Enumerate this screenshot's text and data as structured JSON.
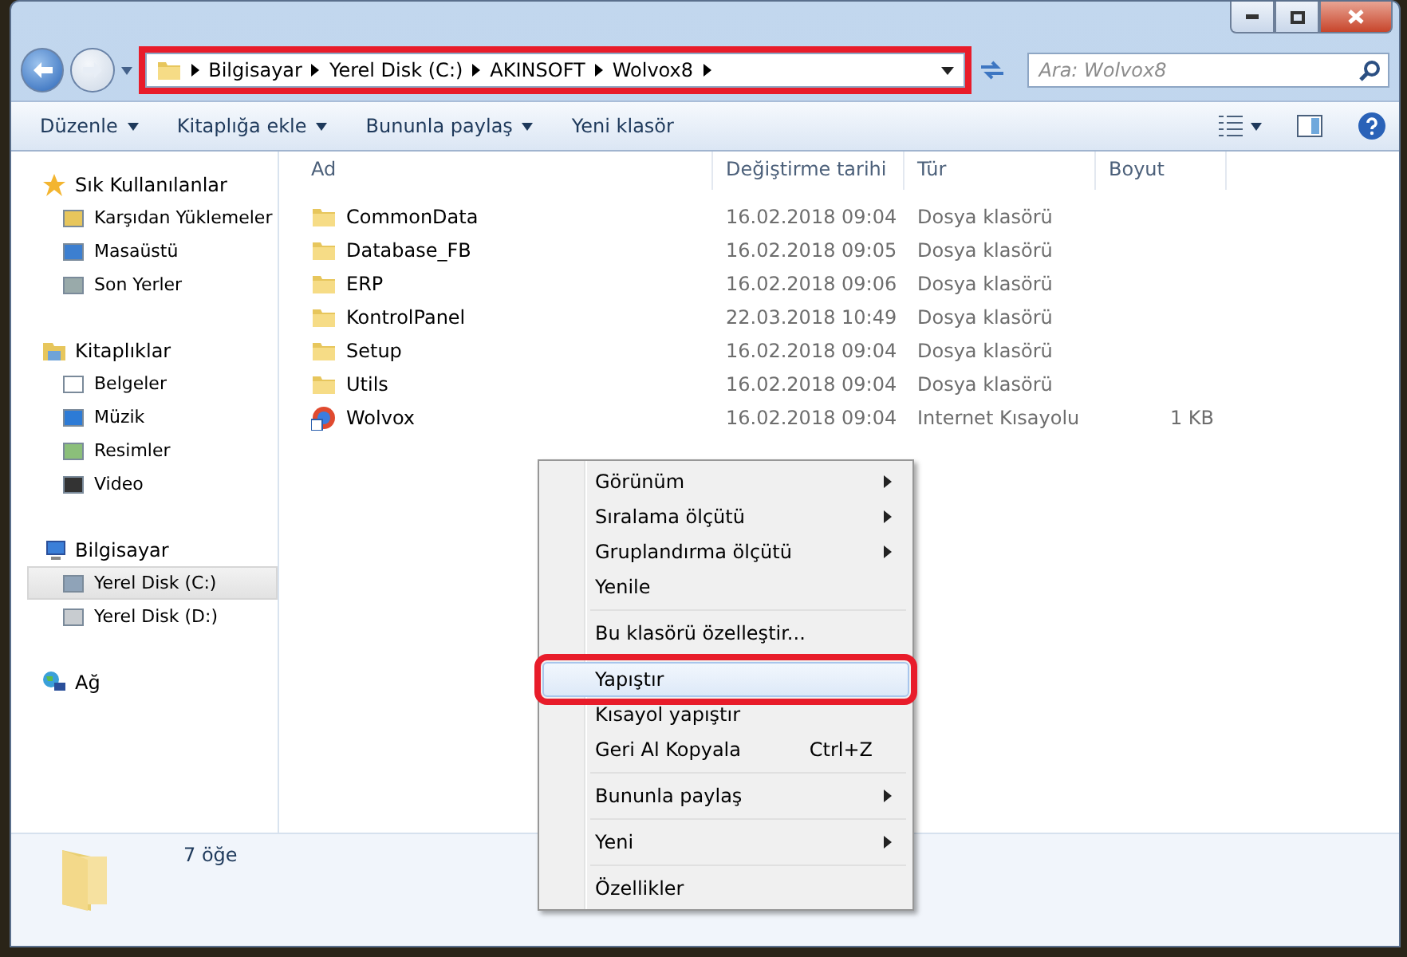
{
  "address_bar": {
    "annotated": true,
    "crumbs": [
      "Bilgisayar",
      "Yerel Disk (C:)",
      "AKINSOFT",
      "Wolvox8"
    ]
  },
  "search": {
    "placeholder": "Ara: Wolvox8"
  },
  "toolbar": {
    "buttons": [
      {
        "label": "Düzenle",
        "dropdown": true
      },
      {
        "label": "Kitaplığa ekle",
        "dropdown": true
      },
      {
        "label": "Bununla paylaş",
        "dropdown": true
      },
      {
        "label": "Yeni klasör",
        "dropdown": false
      }
    ]
  },
  "sidebar": {
    "groups": [
      {
        "label": "Sık Kullanılanlar",
        "children": [
          {
            "label": "Karşıdan Yüklemeler",
            "selected": false
          },
          {
            "label": "Masaüstü",
            "selected": false
          },
          {
            "label": "Son Yerler",
            "selected": false
          }
        ]
      },
      {
        "label": "Kitaplıklar",
        "children": [
          {
            "label": "Belgeler",
            "selected": false
          },
          {
            "label": "Müzik",
            "selected": false
          },
          {
            "label": "Resimler",
            "selected": false
          },
          {
            "label": "Video",
            "selected": false
          }
        ]
      },
      {
        "label": "Bilgisayar",
        "children": [
          {
            "label": "Yerel Disk (C:)",
            "selected": true
          },
          {
            "label": "Yerel Disk (D:)",
            "selected": false
          }
        ]
      },
      {
        "label": "Ağ"
      }
    ]
  },
  "table": {
    "columns": [
      "Ad",
      "Değiştirme tarihi",
      "Tür",
      "Boyut"
    ],
    "rows": [
      {
        "kind": "folder",
        "name": "CommonData",
        "date": "16.02.2018 09:04",
        "type": "Dosya klasörü"
      },
      {
        "kind": "folder",
        "name": "Database_FB",
        "date": "16.02.2018 09:05",
        "type": "Dosya klasörü"
      },
      {
        "kind": "folder",
        "name": "ERP",
        "date": "16.02.2018 09:06",
        "type": "Dosya klasörü"
      },
      {
        "kind": "folder",
        "name": "KontrolPanel",
        "date": "22.03.2018 10:49",
        "type": "Dosya klasörü"
      },
      {
        "kind": "folder",
        "name": "Setup",
        "date": "16.02.2018 09:04",
        "type": "Dosya klasörü"
      },
      {
        "kind": "folder",
        "name": "Utils",
        "date": "16.02.2018 09:04",
        "type": "Dosya klasörü"
      },
      {
        "kind": "shortcut",
        "name": "Wolvox",
        "date": "16.02.2018 09:04",
        "type": "Internet Kısayolu",
        "size": "1 KB"
      }
    ]
  },
  "context_menu": {
    "groups": [
      [
        {
          "label": "Görünüm",
          "submenu": true,
          "selected": false,
          "annotated": false
        },
        {
          "label": "Sıralama ölçütü",
          "submenu": true,
          "selected": false,
          "annotated": false
        },
        {
          "label": "Gruplandırma ölçütü",
          "submenu": true,
          "selected": false,
          "annotated": false
        },
        {
          "label": "Yenile",
          "submenu": false,
          "selected": false,
          "annotated": false
        }
      ],
      [
        {
          "label": "Bu klasörü özelleştir...",
          "submenu": false,
          "selected": false,
          "annotated": false
        }
      ],
      [
        {
          "label": "Yapıştır",
          "submenu": false,
          "selected": true,
          "annotated": true
        },
        {
          "label": "Kısayol yapıştır",
          "submenu": false,
          "selected": false,
          "annotated": false
        },
        {
          "label": "Geri Al Kopyala",
          "shortcut": "Ctrl+Z",
          "submenu": false,
          "selected": false,
          "annotated": false
        }
      ],
      [
        {
          "label": "Bununla paylaş",
          "submenu": true,
          "selected": false,
          "annotated": false
        }
      ],
      [
        {
          "label": "Yeni",
          "submenu": true,
          "selected": false,
          "annotated": false
        }
      ],
      [
        {
          "label": "Özellikler",
          "submenu": false,
          "selected": false,
          "annotated": false
        }
      ]
    ]
  },
  "details_pane": {
    "count": "7 öğe"
  }
}
